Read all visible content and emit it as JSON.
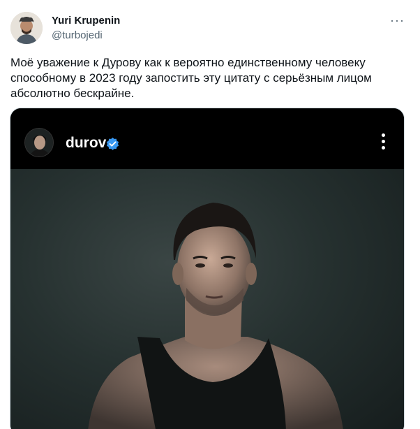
{
  "tweet": {
    "author_name": "Yuri Krupenin",
    "author_handle": "@turbojedi",
    "more_icon": "more-horizontal-icon",
    "text": "Моё уважение к Дурову как к вероятно единственному человеку способному в 2023 году запостить эту цитату с серьёзным лицом абсолютно бескрайне."
  },
  "embedded_post": {
    "username": "durov",
    "verified_icon": "verified-badge-icon",
    "more_icon": "more-vertical-icon",
    "colors": {
      "verified": "#3897f0",
      "header_bg": "#000000"
    }
  }
}
